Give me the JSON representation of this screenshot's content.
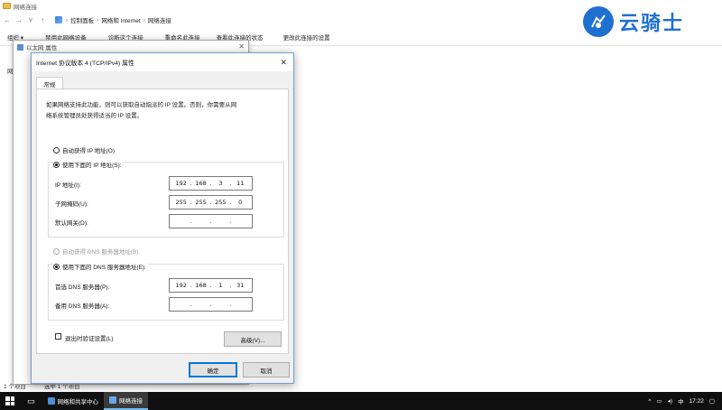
{
  "explorer": {
    "window_title": "网络连接",
    "breadcrumb": [
      "控制面板",
      "网络和 Internet",
      "网络连接"
    ],
    "commands": [
      "组织 ▾",
      "禁用此网络设备",
      "诊断这个连接",
      "重命名此连接",
      "查看此连接的状态",
      "更改此连接的设置"
    ],
    "status_count": "1 个项目",
    "status_selected": "选中 1 个项目",
    "side_labels": [
      "网",
      "连",
      "此"
    ]
  },
  "ethernet_props": {
    "title": "以太网 属性"
  },
  "ipv4_dialog": {
    "title": "Internet 协议版本 4 (TCP/IPv4) 属性",
    "tab_general": "常规",
    "description_line1": "如果网络支持此功能，则可以获取自动指派的 IP 设置。否则，你需要从网",
    "description_line2": "络系统管理员处获得适当的 IP 设置。",
    "auto_ip_label": "自动获得 IP 地址(O)",
    "manual_ip_label": "使用下面的 IP 地址(S):",
    "ip_address_label": "IP 地址(I):",
    "ip_address": [
      "192",
      "168",
      "3",
      "11"
    ],
    "subnet_label": "子网掩码(U):",
    "subnet": [
      "255",
      "255",
      "255",
      "0"
    ],
    "gateway_label": "默认网关(D):",
    "gateway": [
      "",
      "",
      "",
      ""
    ],
    "auto_dns_label": "自动获得 DNS 服务器地址(B)",
    "manual_dns_label": "使用下面的 DNS 服务器地址(E):",
    "preferred_dns_label": "首选 DNS 服务器(P):",
    "preferred_dns": [
      "192",
      "168",
      "1",
      "31"
    ],
    "alternate_dns_label": "备用 DNS 服务器(A):",
    "alternate_dns": [
      "",
      "",
      "",
      ""
    ],
    "validate_label": "退出时验证设置(L)",
    "advanced_button": "高级(V)...",
    "ok_button": "确定",
    "cancel_button": "取消"
  },
  "taskbar": {
    "item1": "网络和共享中心",
    "item2": "网络连接",
    "ime": "中",
    "time": "17:22"
  },
  "watermark": {
    "text": "云骑士"
  },
  "colors": {
    "accent": "#0078d7",
    "taskbar": "#101010",
    "watermark": "#1f6fd1"
  }
}
